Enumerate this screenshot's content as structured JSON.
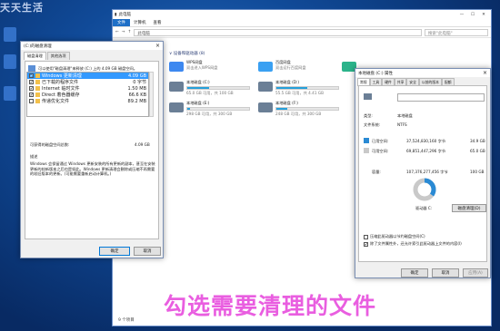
{
  "desktop": {
    "title": "天天生活"
  },
  "explorer": {
    "title": "此电脑",
    "tabs": [
      "文件",
      "计算机",
      "查看"
    ],
    "address": "此电脑",
    "search_placeholder": "搜索\"此电脑\"",
    "section": "∨ 设备和驱动器 (8)",
    "drives": [
      {
        "name": "WPS网盘",
        "sub": "双击进入WPS网盘",
        "size": "",
        "icon_color": "#3d88f0",
        "fill": null
      },
      {
        "name": "百度网盘",
        "sub": "双击运行百度网盘",
        "size": "",
        "icon_color": "#3aa0f2",
        "fill": null
      },
      {
        "name": "本地磁盘 (C:)",
        "sub": "",
        "size": "65.0 GB 可用，共 100 GB",
        "icon_color": "#6b7f96",
        "fill": 0.35
      },
      {
        "name": "本地磁盘 (D:)",
        "sub": "",
        "size": "55.5 GB 可用，共 4.41 GB",
        "icon_color": "#6b7f96",
        "fill": 0.5
      },
      {
        "name": "本地磁盘 (E:)",
        "sub": "",
        "size": "298 GB 可用，共 300 GB",
        "icon_color": "#6b7f96",
        "fill": 0.05
      },
      {
        "name": "本地磁盘 (F:)",
        "sub": "",
        "size": "248 GB 可用，共 300 GB",
        "icon_color": "#6b7f96",
        "fill": 0.17
      }
    ],
    "status": "9 个项目"
  },
  "cleanup": {
    "title": "(C:)的磁盘清理",
    "tabs": [
      "磁盘清理",
      "其他选项"
    ],
    "intro": "可以使用\"磁盘清理\"来释放 (C:) 上的 4.09 GB 磁盘空间。",
    "list_label": "要删除的文件(F):",
    "items": [
      {
        "checked": "✔",
        "name": "Windows 更新清理",
        "size": "4.09 GB"
      },
      {
        "checked": "✔",
        "name": "已下载的程序文件",
        "size": "0 字节"
      },
      {
        "checked": "✔",
        "name": "Internet 临时文件",
        "size": "1.50 MB"
      },
      {
        "checked": "✔",
        "name": "Direct 着色器缓存",
        "size": "66.6 KB"
      },
      {
        "checked": "",
        "name": "传递优化文件",
        "size": "89.2 MB"
      }
    ],
    "total_label": "可获得的磁盘空间总数:",
    "total_value": "4.09 GB",
    "desc_title": "描述",
    "desc": "Windows 会保留通过 Windows 更新安装的所有更新的副本，甚至在安装更新的较新版本之后也是如此。Windows 更新清理会删除或压缩不再需要的较旧版本的更新。(可能需要重新启动计算机。)",
    "ok": "确定",
    "cancel": "取消"
  },
  "props": {
    "title": "本地磁盘 (C:) 属性",
    "tabs": [
      "常规",
      "工具",
      "硬件",
      "共享",
      "安全",
      "以前的版本",
      "配额"
    ],
    "type_label": "类型:",
    "type_value": "本地磁盘",
    "fs_label": "文件系统:",
    "fs_value": "NTFS",
    "used_label": "已用空间:",
    "used_bytes": "37,524,830,160 字节",
    "used_gb": "34.9 GB",
    "free_label": "可用空间:",
    "free_bytes": "69,851,447,296 字节",
    "free_gb": "65.0 GB",
    "cap_label": "容量:",
    "cap_bytes": "107,376,277,456 字节",
    "cap_gb": "100 GB",
    "drive_label": "驱动器 C:",
    "cleanup_btn": "磁盘清理(D)",
    "opt1": "压缩此驱动器以节约磁盘空间(C)",
    "opt2": "除了文件属性外，还允许索引此驱动器上文件的内容(I)",
    "ok": "确定",
    "cancel": "取消",
    "apply": "应用(A)",
    "used_fraction": 0.35,
    "used_color": "#2a8ad4",
    "free_color": "#c9c9c9"
  },
  "caption": "勾选需要清理的文件"
}
